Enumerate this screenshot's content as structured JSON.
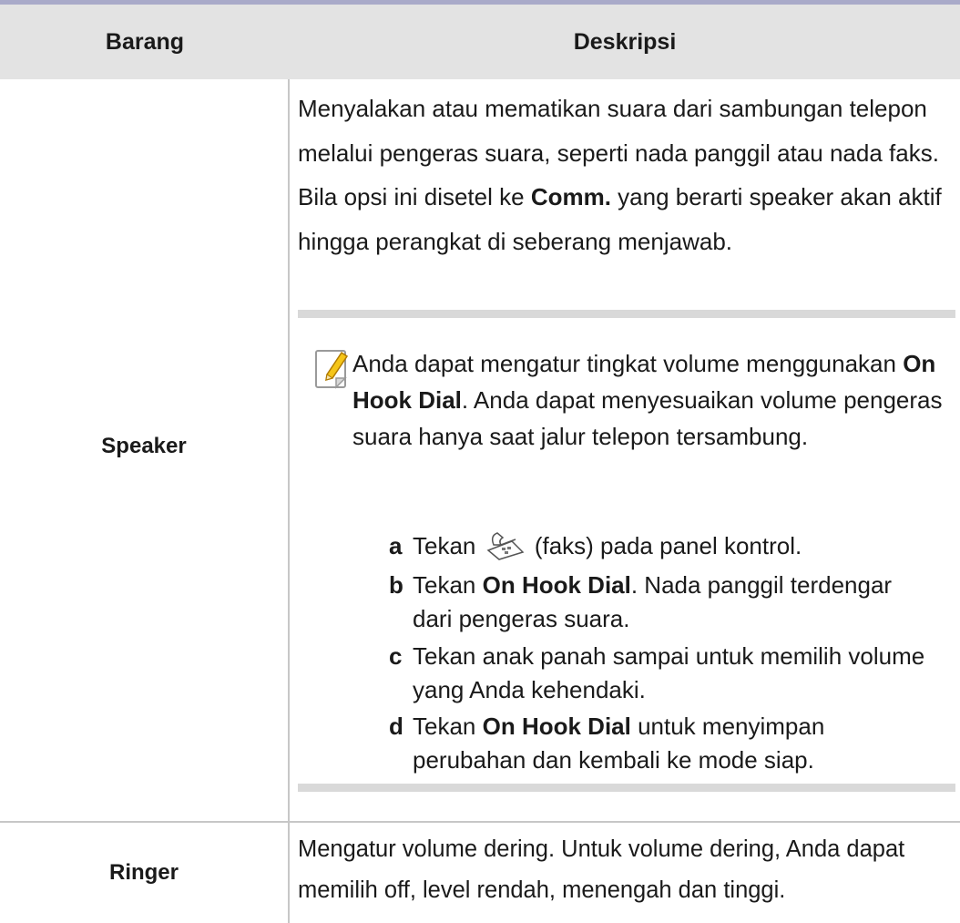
{
  "table": {
    "headers": {
      "item": "Barang",
      "description": "Deskripsi"
    },
    "speaker": {
      "label": "Speaker",
      "desc_1": "Menyalakan atau mematikan suara dari sambungan telepon melalui pengeras suara, seperti nada panggil atau nada faks. Bila opsi ini disetel ke ",
      "desc_bold": "Comm.",
      "desc_2": " yang berarti speaker akan aktif hingga perangkat di seberang menjawab.",
      "note": {
        "icon": "note-pencil-icon",
        "text_1": "Anda dapat mengatur tingkat volume menggunakan ",
        "text_bold": "On Hook Dial",
        "text_2": ". Anda dapat menyesuaikan volume pengeras suara hanya saat jalur telepon tersambung.",
        "steps": [
          {
            "letter": "a",
            "pre": "Tekan ",
            "icon": "fax-icon",
            "post": " (faks) pada panel kontrol."
          },
          {
            "letter": "b",
            "pre": "Tekan ",
            "bold": "On Hook Dial",
            "post": ". Nada panggil terdengar dari pengeras suara."
          },
          {
            "letter": "c",
            "pre": "Tekan anak panah sampai untuk memilih volume yang Anda kehendaki."
          },
          {
            "letter": "d",
            "pre": "Tekan ",
            "bold": "On Hook Dial",
            "post": " untuk menyimpan perubahan dan kembali ke mode siap."
          }
        ]
      }
    },
    "ringer": {
      "label": "Ringer",
      "desc": "Mengatur volume dering. Untuk volume dering, Anda dapat memilih off, level rendah, menengah dan tinggi."
    }
  }
}
